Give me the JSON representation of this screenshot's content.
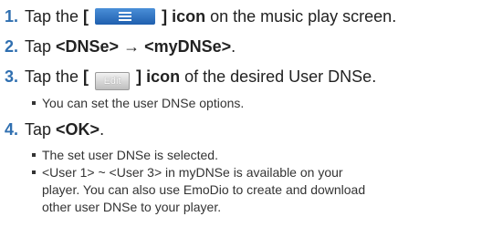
{
  "steps": [
    {
      "number": "1.",
      "pre": "Tap the ",
      "bracket_open": "[",
      "bracket_close": "]",
      "icon_word": " icon",
      "post": " on the music play screen.",
      "button_icon": "menu-icon"
    },
    {
      "number": "2.",
      "pre": "Tap ",
      "first": "<DNSe>",
      "arrow": " → ",
      "second": "<myDNSe>",
      "end": "."
    },
    {
      "number": "3.",
      "pre": "Tap the ",
      "bracket_open": "[",
      "button_label": "Edit",
      "bracket_close": "]",
      "icon_word": " icon",
      "post": " of the desired User DNSe.",
      "bullets": [
        "You can set the user DNSe options."
      ]
    },
    {
      "number": "4.",
      "pre": "Tap ",
      "ok": "<OK>",
      "end": ".",
      "bullets": [
        "The set user DNSe is selected.",
        "<User 1> ~ <User 3> in myDNSe is available on your",
        "player. You can also use EmoDio to create and download",
        "other user DNSe to your player."
      ]
    }
  ],
  "colors": {
    "step_number": "#2f6fb0",
    "menu_button": "#2a6fc4",
    "text": "#222222"
  }
}
